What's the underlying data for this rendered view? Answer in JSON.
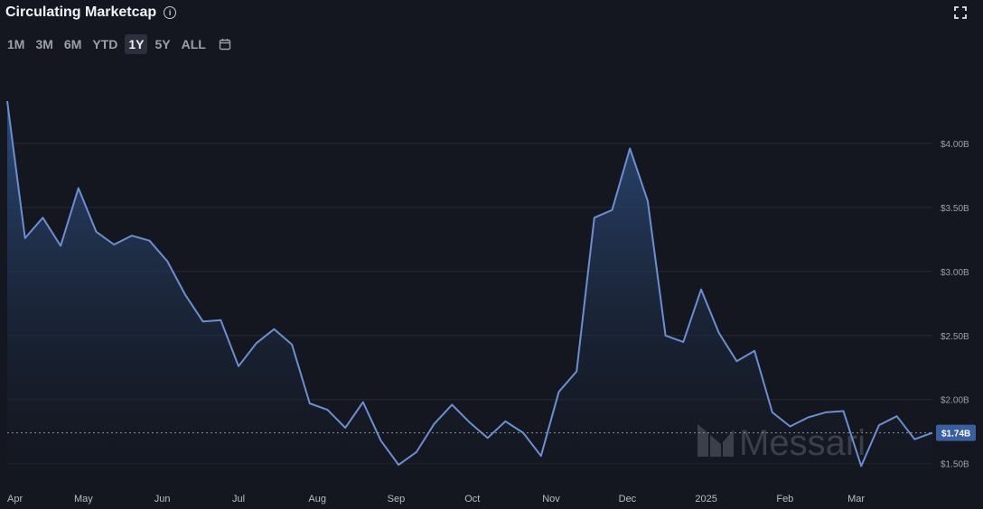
{
  "header": {
    "title": "Circulating Marketcap",
    "info_icon": "info-icon",
    "expand_icon": "expand-icon"
  },
  "ranges": {
    "items": [
      "1M",
      "3M",
      "6M",
      "YTD",
      "1Y",
      "5Y",
      "ALL"
    ],
    "active": "1Y",
    "calendar_icon": "calendar-icon"
  },
  "watermark": {
    "text": "Messari",
    "logo_icon": "messari-logo-icon"
  },
  "colors": {
    "line": "#6b8fd0",
    "fill_top": "#2e4f82",
    "fill_bottom": "#141720",
    "grid": "#262a35",
    "badge": "#3a5f9f"
  },
  "chart_data": {
    "type": "area",
    "title": "Circulating Marketcap",
    "unit": "USD",
    "ylim": [
      1.35,
      4.45
    ],
    "y_ticks": [
      {
        "value": 1.5,
        "label": "$1.50B"
      },
      {
        "value": 2.0,
        "label": "$2.00B"
      },
      {
        "value": 2.5,
        "label": "$2.50B"
      },
      {
        "value": 3.0,
        "label": "$3.00B"
      },
      {
        "value": 3.5,
        "label": "$3.50B"
      },
      {
        "value": 4.0,
        "label": "$4.00B"
      }
    ],
    "x_range": [
      "2024-04-01",
      "2025-03-31"
    ],
    "x_ticks": [
      {
        "date": "2024-04-01",
        "label": "Apr"
      },
      {
        "date": "2024-05-01",
        "label": "May"
      },
      {
        "date": "2024-06-01",
        "label": "Jun"
      },
      {
        "date": "2024-07-01",
        "label": "Jul"
      },
      {
        "date": "2024-08-01",
        "label": "Aug"
      },
      {
        "date": "2024-09-01",
        "label": "Sep"
      },
      {
        "date": "2024-10-01",
        "label": "Oct"
      },
      {
        "date": "2024-11-01",
        "label": "Nov"
      },
      {
        "date": "2024-12-01",
        "label": "Dec"
      },
      {
        "date": "2025-01-01",
        "label": "2025"
      },
      {
        "date": "2025-02-01",
        "label": "Feb"
      },
      {
        "date": "2025-03-01",
        "label": "Mar"
      }
    ],
    "current_value": {
      "value": 1.74,
      "label": "$1.74B"
    },
    "grid": true,
    "series": [
      {
        "points": [
          [
            "2024-04-01",
            4.33
          ],
          [
            "2024-04-08",
            3.26
          ],
          [
            "2024-04-15",
            3.42
          ],
          [
            "2024-04-22",
            3.2
          ],
          [
            "2024-04-29",
            3.65
          ],
          [
            "2024-05-06",
            3.31
          ],
          [
            "2024-05-13",
            3.21
          ],
          [
            "2024-05-20",
            3.28
          ],
          [
            "2024-05-27",
            3.24
          ],
          [
            "2024-06-03",
            3.08
          ],
          [
            "2024-06-10",
            2.82
          ],
          [
            "2024-06-17",
            2.61
          ],
          [
            "2024-06-24",
            2.62
          ],
          [
            "2024-07-01",
            2.26
          ],
          [
            "2024-07-08",
            2.44
          ],
          [
            "2024-07-15",
            2.55
          ],
          [
            "2024-07-22",
            2.43
          ],
          [
            "2024-07-29",
            1.97
          ],
          [
            "2024-08-05",
            1.92
          ],
          [
            "2024-08-12",
            1.78
          ],
          [
            "2024-08-19",
            1.98
          ],
          [
            "2024-08-26",
            1.68
          ],
          [
            "2024-09-02",
            1.49
          ],
          [
            "2024-09-09",
            1.59
          ],
          [
            "2024-09-16",
            1.81
          ],
          [
            "2024-09-23",
            1.96
          ],
          [
            "2024-09-30",
            1.82
          ],
          [
            "2024-10-07",
            1.7
          ],
          [
            "2024-10-14",
            1.83
          ],
          [
            "2024-10-21",
            1.74
          ],
          [
            "2024-10-28",
            1.56
          ],
          [
            "2024-11-04",
            2.06
          ],
          [
            "2024-11-11",
            2.22
          ],
          [
            "2024-11-18",
            3.42
          ],
          [
            "2024-11-25",
            3.48
          ],
          [
            "2024-12-02",
            3.96
          ],
          [
            "2024-12-09",
            3.55
          ],
          [
            "2024-12-16",
            2.5
          ],
          [
            "2024-12-23",
            2.45
          ],
          [
            "2024-12-30",
            2.86
          ],
          [
            "2025-01-06",
            2.52
          ],
          [
            "2025-01-13",
            2.3
          ],
          [
            "2025-01-20",
            2.38
          ],
          [
            "2025-01-27",
            1.9
          ],
          [
            "2025-02-03",
            1.79
          ],
          [
            "2025-02-10",
            1.86
          ],
          [
            "2025-02-17",
            1.9
          ],
          [
            "2025-02-24",
            1.91
          ],
          [
            "2025-03-03",
            1.48
          ],
          [
            "2025-03-10",
            1.8
          ],
          [
            "2025-03-17",
            1.87
          ],
          [
            "2025-03-24",
            1.69
          ],
          [
            "2025-03-31",
            1.74
          ]
        ]
      }
    ]
  }
}
